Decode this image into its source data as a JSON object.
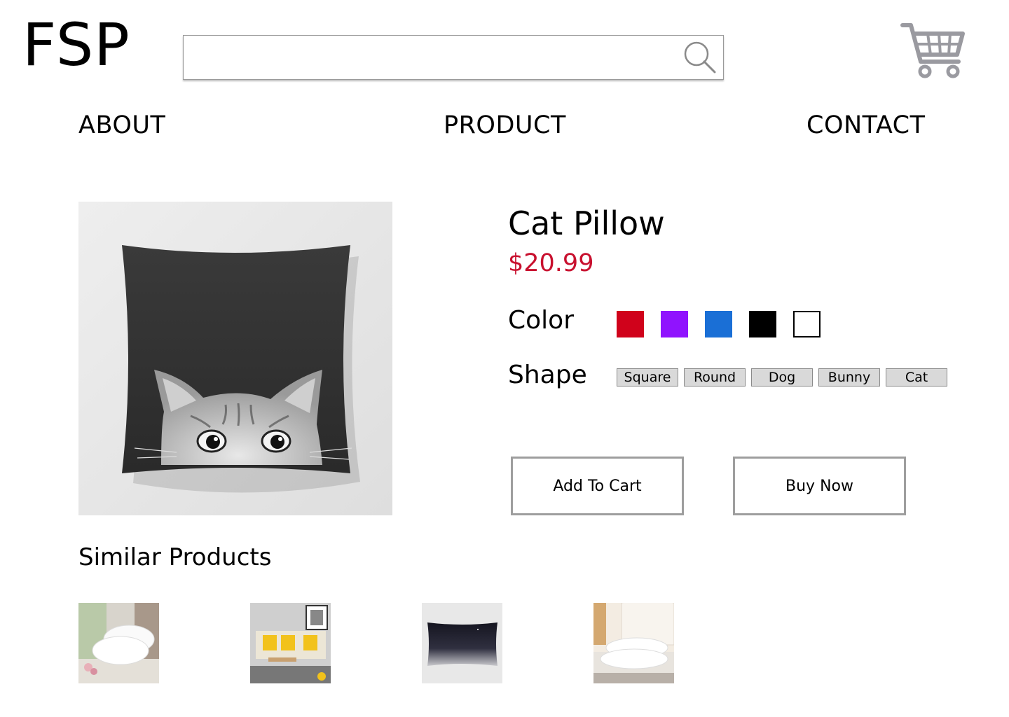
{
  "header": {
    "logo_text": "FSP",
    "search": {
      "placeholder": "",
      "value": "",
      "icon": "search-icon"
    },
    "cart_icon": "shopping-cart-icon"
  },
  "nav": {
    "items": [
      {
        "label": "ABOUT"
      },
      {
        "label": "PRODUCT"
      },
      {
        "label": "CONTACT"
      }
    ]
  },
  "product": {
    "title": "Cat Pillow",
    "price": "$20.99",
    "image": "black pillow with peeking cat photo",
    "color_label": "Color",
    "colors": [
      "#d0021b",
      "#9013fe",
      "#1a6fd6",
      "#000000",
      "#ffffff"
    ],
    "shape_label": "Shape",
    "shapes": [
      "Square",
      "Round",
      "Dog",
      "Bunny",
      "Cat"
    ],
    "add_to_cart_label": "Add To Cart",
    "buy_now_label": "Buy Now"
  },
  "similar": {
    "heading": "Similar Products",
    "items": [
      {
        "image": "white bed pillows by window"
      },
      {
        "image": "yellow striped cushions on sofa"
      },
      {
        "image": "dark gradient rectangular pillow"
      },
      {
        "image": "white pillows stacked on bed"
      }
    ]
  },
  "colors": {
    "price": "#c8102e",
    "cart_icon": "#9a9aa0",
    "button_border": "#9e9e9e"
  }
}
